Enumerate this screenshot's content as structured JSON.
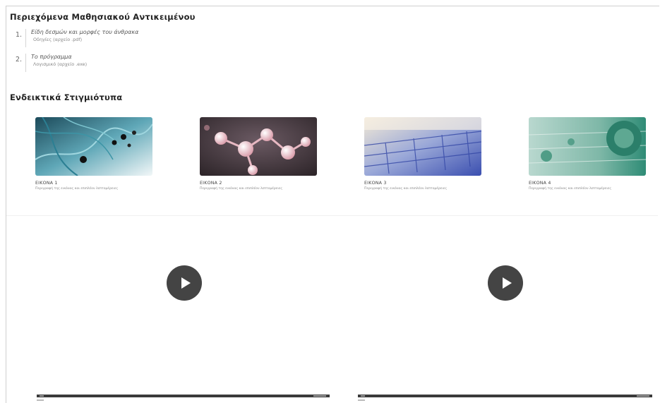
{
  "contents": {
    "heading": "Περιεχόμενα Μαθησιακού Αντικειμένου",
    "items": [
      {
        "number": "1.",
        "title": "Είδη δεσμών και μορφές του άνθρακα",
        "subtitle": "Οδηγίες (αρχείο .pdf)"
      },
      {
        "number": "2.",
        "title": "Το πρόγραμμα",
        "subtitle": "Λογισμικό (αρχείο .exe)"
      }
    ]
  },
  "screenshots": {
    "heading": "Ενδεικτικά Στιγμιότυπα",
    "cards": [
      {
        "title": "ΕΙΚΟΝΑ 1",
        "description": "Περιγραφή της εικόνας και επιπλέον λεπτομέρειες",
        "icon": "fungal-hyphae-micrograph"
      },
      {
        "title": "ΕΙΚΟΝΑ 2",
        "description": "Περιγραφή της εικόνας και επιπλέον λεπτομέρειες",
        "icon": "molecule-model"
      },
      {
        "title": "ΕΙΚΟΝΑ 3",
        "description": "Περιγραφή της εικόνας και επιπλέον λεπτομέρειες",
        "icon": "cell-micrograph"
      },
      {
        "title": "ΕΙΚΟΝΑ 4",
        "description": "Περιγραφή της εικόνας και επιπλέον λεπτομέρειες",
        "icon": "plant-cell-micrograph"
      }
    ]
  },
  "videos": [
    {
      "icon": "play-icon"
    },
    {
      "icon": "play-icon"
    }
  ],
  "colors": {
    "play_button": "#444444",
    "control_bar": "#3a3a3a"
  }
}
